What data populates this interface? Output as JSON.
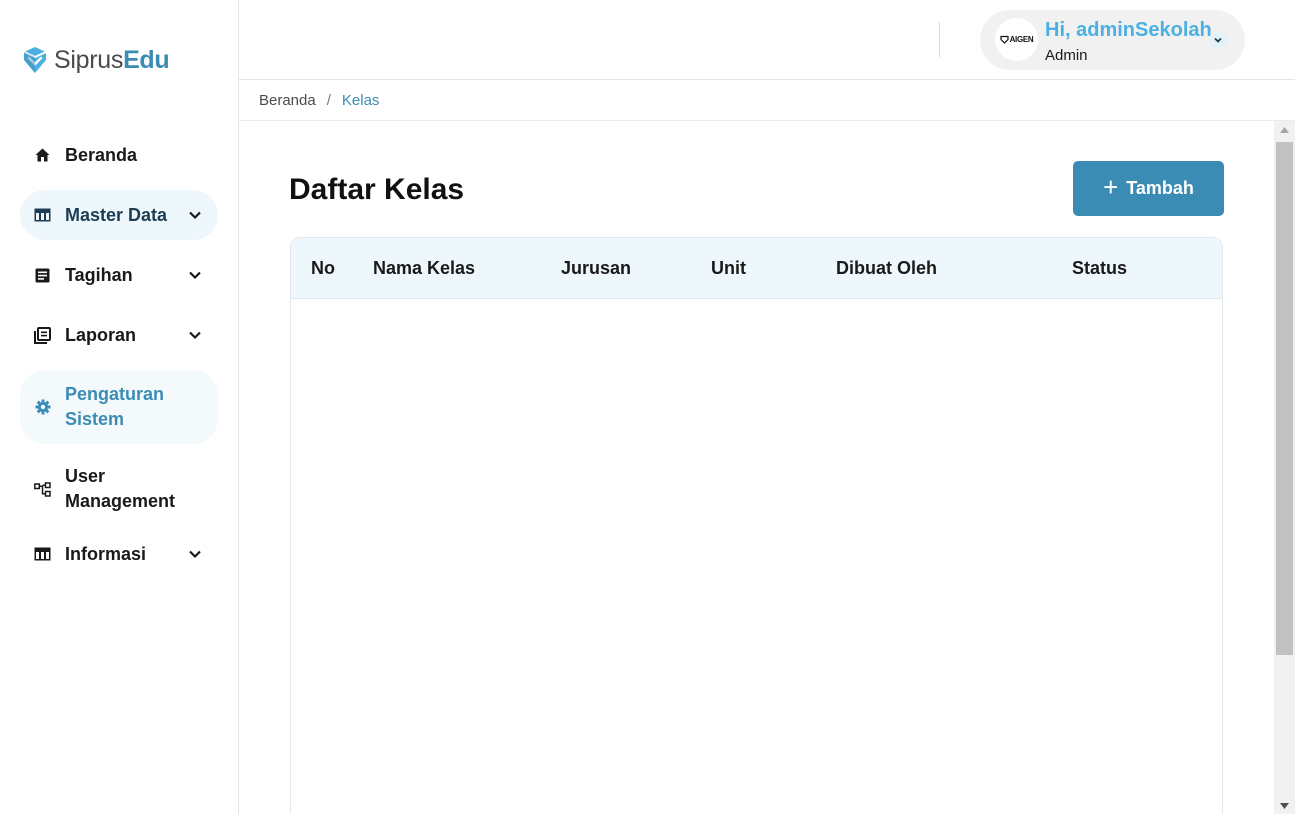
{
  "brand": {
    "name_part1": "Siprus",
    "name_part2": "Edu",
    "accent_color": "#3a8cb4"
  },
  "sidebar": {
    "items": [
      {
        "label": "Beranda",
        "icon": "home-icon",
        "has_chevron": false
      },
      {
        "label": "Master Data",
        "icon": "table-icon",
        "has_chevron": true,
        "active": true
      },
      {
        "label": "Tagihan",
        "icon": "invoice-icon",
        "has_chevron": true
      },
      {
        "label": "Laporan",
        "icon": "report-icon",
        "has_chevron": true
      },
      {
        "label_line1": "Pengaturan",
        "label_line2": "Sistem",
        "icon": "gear-icon",
        "has_chevron": false
      },
      {
        "label_line1": "User",
        "label_line2": "Management",
        "icon": "user-tree-icon",
        "has_chevron": false
      },
      {
        "label": "Informasi",
        "icon": "table-icon",
        "has_chevron": true
      }
    ]
  },
  "header": {
    "user": {
      "greeting": "Hi, adminSekolah",
      "role": "Admin",
      "avatar_text": "AIGEN"
    }
  },
  "breadcrumb": {
    "home": "Beranda",
    "separator": "/",
    "current": "Kelas"
  },
  "main": {
    "title": "Daftar Kelas",
    "add_button_label": "Tambah",
    "table": {
      "columns": [
        "No",
        "Nama Kelas",
        "Jurusan",
        "Unit",
        "Dibuat Oleh",
        "Status"
      ],
      "rows": []
    }
  }
}
